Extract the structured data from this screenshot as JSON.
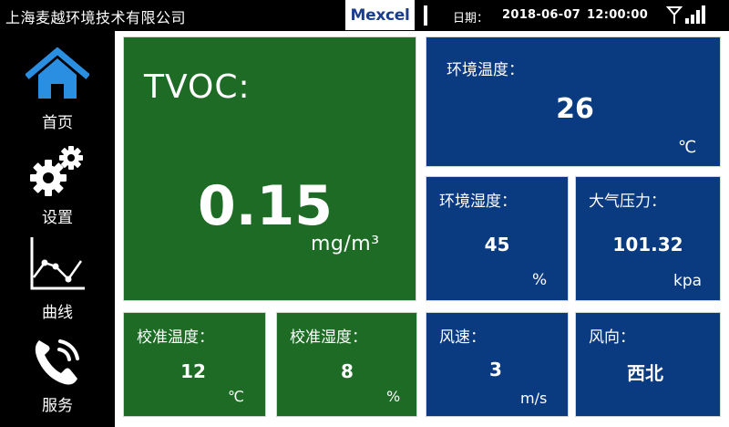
{
  "header": {
    "company": "上海麦越环境技术有限公司",
    "brand": "Mexcel",
    "date_label": "日期：",
    "date": "2018-06-07",
    "time": "12:00:00",
    "signal_icon": "signal-strength-icon"
  },
  "sidebar": {
    "items": [
      {
        "label": "首页",
        "icon": "home-icon"
      },
      {
        "label": "设置",
        "icon": "gear-icon"
      },
      {
        "label": "曲线",
        "icon": "line-chart-icon"
      },
      {
        "label": "服务",
        "icon": "phone-icon"
      }
    ]
  },
  "readings": {
    "tvoc": {
      "label": "TVOC:",
      "value": "0.15",
      "unit": "mg/m³"
    },
    "temperature": {
      "label": "环境温度：",
      "value": "26",
      "unit": "℃"
    },
    "humidity": {
      "label": "环境湿度：",
      "value": "45",
      "unit": "%"
    },
    "pressure": {
      "label": "大气压力：",
      "value": "101.32",
      "unit": "kpa"
    },
    "cal_temperature": {
      "label": "校准温度：",
      "value": "12",
      "unit": "℃"
    },
    "cal_humidity": {
      "label": "校准湿度：",
      "value": "8",
      "unit": "%"
    },
    "wind_speed": {
      "label": "风速：",
      "value": "3",
      "unit": "m/s"
    },
    "wind_direction": {
      "label": "风向：",
      "value": "西北"
    }
  },
  "colors": {
    "green_card": "#1e6b26",
    "blue_card": "#0a3a80",
    "home_icon": "#2a8fe0",
    "brand_text": "#1a3e8c"
  }
}
